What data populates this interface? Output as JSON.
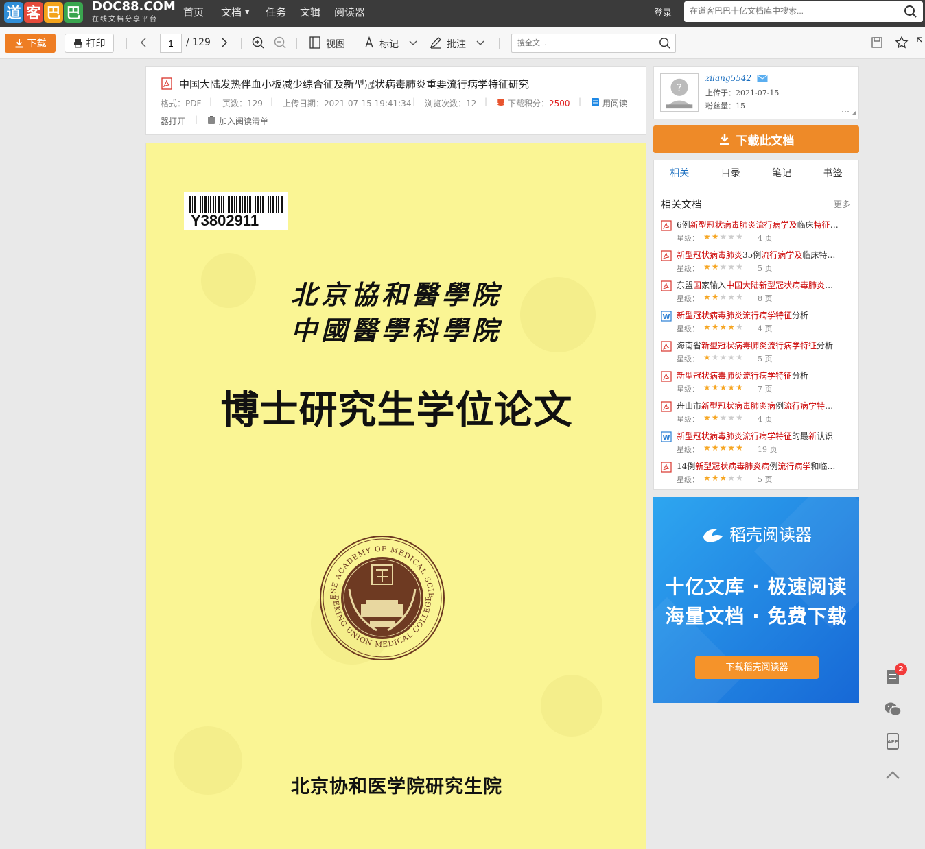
{
  "topnav": {
    "logo_chars": [
      "道",
      "客",
      "巴",
      "巴"
    ],
    "logo_colors": [
      "#2f8ed8",
      "#e64a3b",
      "#f4a41b",
      "#3aa64f"
    ],
    "logo_en": "DOC88.COM",
    "logo_sub": "在线文档分享平台",
    "items": [
      "首页",
      "文档",
      "任务",
      "文辑",
      "阅读器"
    ],
    "login": "登录",
    "search_placeholder": "在道客巴巴十亿文档库中搜索..."
  },
  "toolbar": {
    "download": "下载",
    "print": "打印",
    "page_current": "1",
    "page_total": "/ 129",
    "view": "视图",
    "mark": "标记",
    "annotate": "批注",
    "search_placeholder": "搜全文..."
  },
  "doc": {
    "title": "中国大陆发热伴血小板减少综合征及新型冠状病毒肺炎重要流行病学特征研究",
    "format_label": "格式：PDF",
    "pages_label": "页数：129",
    "upload_label": "上传日期：2021-07-15 19:41:34",
    "views_label": "浏览次数：12",
    "points_label": "下载积分：",
    "points_value": "2500",
    "open_reader_1": "用阅读",
    "open_reader_2": "器打开",
    "add_list": "加入阅读清单"
  },
  "page_content": {
    "barcode": "Y3802911",
    "school1": "北京協和醫學院",
    "school2": "中國醫學科學院",
    "heading": "博士研究生学位论文",
    "seal_text_top": "CHINESE ACADEMY OF MEDICAL SCIENCES",
    "seal_text_bottom": "PEKING UNION MEDICAL COLLEGE",
    "footer": "北京协和医学院研究生院"
  },
  "user": {
    "name": "zilang5542",
    "uploaded": "上传于：2021-07-15",
    "fans": "粉丝量：15"
  },
  "sidebar": {
    "download_btn": "下载此文档",
    "tabs": [
      "相关",
      "目录",
      "笔记",
      "书签"
    ],
    "related_title": "相关文档",
    "more": "更多",
    "star_label": "星级：",
    "items": [
      {
        "parts": [
          [
            "6例",
            0
          ],
          [
            "新型冠状病毒肺炎流行病学及",
            1
          ],
          [
            "临床",
            0
          ],
          [
            "特征",
            1
          ],
          [
            "…",
            0
          ]
        ],
        "stars": 2,
        "pages": "4 页",
        "type": "pdf"
      },
      {
        "parts": [
          [
            "新型冠状病毒肺炎",
            1
          ],
          [
            "35例",
            0
          ],
          [
            "流行病学及",
            1
          ],
          [
            "临床特…",
            0
          ]
        ],
        "stars": 2,
        "pages": "5 页",
        "type": "pdf"
      },
      {
        "parts": [
          [
            "东盟",
            0
          ],
          [
            "国",
            1
          ],
          [
            "家输入",
            0
          ],
          [
            "中国大陆新型冠状病毒肺炎",
            1
          ],
          [
            "…",
            0
          ]
        ],
        "stars": 2,
        "pages": "8 页",
        "type": "pdf"
      },
      {
        "parts": [
          [
            "新型冠状病毒肺炎流行病学特征",
            1
          ],
          [
            "分析",
            0
          ]
        ],
        "stars": 4,
        "pages": "4 页",
        "type": "word"
      },
      {
        "parts": [
          [
            "海南省",
            0
          ],
          [
            "新型冠状病毒肺炎流行病学特征",
            1
          ],
          [
            "分析",
            0
          ]
        ],
        "stars": 1,
        "pages": "5 页",
        "type": "pdf"
      },
      {
        "parts": [
          [
            "新型冠状病毒肺炎流行病学特征",
            1
          ],
          [
            "分析",
            0
          ]
        ],
        "stars": 5,
        "pages": "7 页",
        "type": "pdf"
      },
      {
        "parts": [
          [
            "舟山市",
            0
          ],
          [
            "新型冠状病毒肺炎病",
            1
          ],
          [
            "例",
            0
          ],
          [
            "流行病学特",
            1
          ],
          [
            "…",
            0
          ]
        ],
        "stars": 2,
        "pages": "4 页",
        "type": "pdf"
      },
      {
        "parts": [
          [
            "新型冠状病毒肺炎流行病学特征",
            1
          ],
          [
            "的最",
            0
          ],
          [
            "新",
            1
          ],
          [
            "认识",
            0
          ]
        ],
        "stars": 5,
        "pages": "19 页",
        "type": "word"
      },
      {
        "parts": [
          [
            "14例",
            0
          ],
          [
            "新型冠状病毒肺炎病",
            1
          ],
          [
            "例",
            0
          ],
          [
            "流行病学",
            1
          ],
          [
            "和临…",
            0
          ]
        ],
        "stars": 3,
        "pages": "5 页",
        "type": "pdf"
      }
    ]
  },
  "ad": {
    "brand": "稻壳阅读器",
    "line1": "十亿文库 · 极速阅读",
    "line2": "海量文档 · 免费下载",
    "button": "下载稻壳阅读器"
  },
  "float": {
    "badge": "2"
  },
  "colors": {
    "accent_orange": "#ee7d23",
    "highlight_red": "#cc0000",
    "link_blue": "#1a6ebf",
    "page_yellow": "#faf594",
    "star": "#f6a623"
  }
}
